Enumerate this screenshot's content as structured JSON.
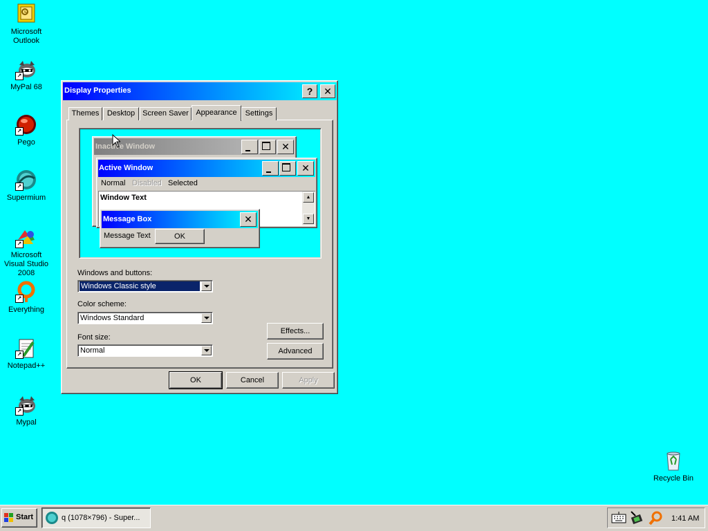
{
  "desktop": {
    "icons": [
      {
        "label": "Microsoft Outlook",
        "icon": "outlook-icon"
      },
      {
        "label": "MyPal 68",
        "icon": "mypal-icon"
      },
      {
        "label": "Pego",
        "icon": "pego-icon"
      },
      {
        "label": "Supermium",
        "icon": "supermium-icon"
      },
      {
        "label": "Microsoft Visual Studio 2008",
        "icon": "visual-studio-icon"
      },
      {
        "label": "Everything",
        "icon": "everything-icon"
      },
      {
        "label": "Notepad++",
        "icon": "notepadpp-icon"
      },
      {
        "label": "Mypal",
        "icon": "mypal-icon"
      },
      {
        "label": "Recycle Bin",
        "icon": "recycle-bin-icon"
      }
    ]
  },
  "dialog": {
    "title": "Display Properties",
    "help_glyph": "?",
    "close_glyph": "✕",
    "tabs": [
      "Themes",
      "Desktop",
      "Screen Saver",
      "Appearance",
      "Settings"
    ],
    "active_tab": "Appearance",
    "preview": {
      "inactive_title": "Inactive Window",
      "active_title": "Active Window",
      "menu_normal": "Normal",
      "menu_disabled": "Disabled",
      "menu_selected": "Selected",
      "window_text": "Window Text",
      "msgbox_title": "Message Box",
      "msgbox_text": "Message Text",
      "msgbox_ok": "OK"
    },
    "windows_buttons_label": "Windows and buttons:",
    "windows_buttons_value": "Windows Classic style",
    "color_scheme_label": "Color scheme:",
    "color_scheme_value": "Windows Standard",
    "font_size_label": "Font size:",
    "font_size_value": "Normal",
    "effects_button": "Effects...",
    "advanced_button": "Advanced",
    "ok_button": "OK",
    "cancel_button": "Cancel",
    "apply_button": "Apply"
  },
  "taskbar": {
    "start_label": "Start",
    "task_label": "q (1078×796) - Super...",
    "clock": "1:41 AM"
  },
  "colors": {
    "desktop": "#00ffff",
    "title_active_start": "#0000ff",
    "title_active_end": "#00ffff",
    "title_inactive_start": "#808080",
    "title_inactive_end": "#c0c0c0",
    "face": "#d4d0c8",
    "selection": "#0a246a"
  }
}
